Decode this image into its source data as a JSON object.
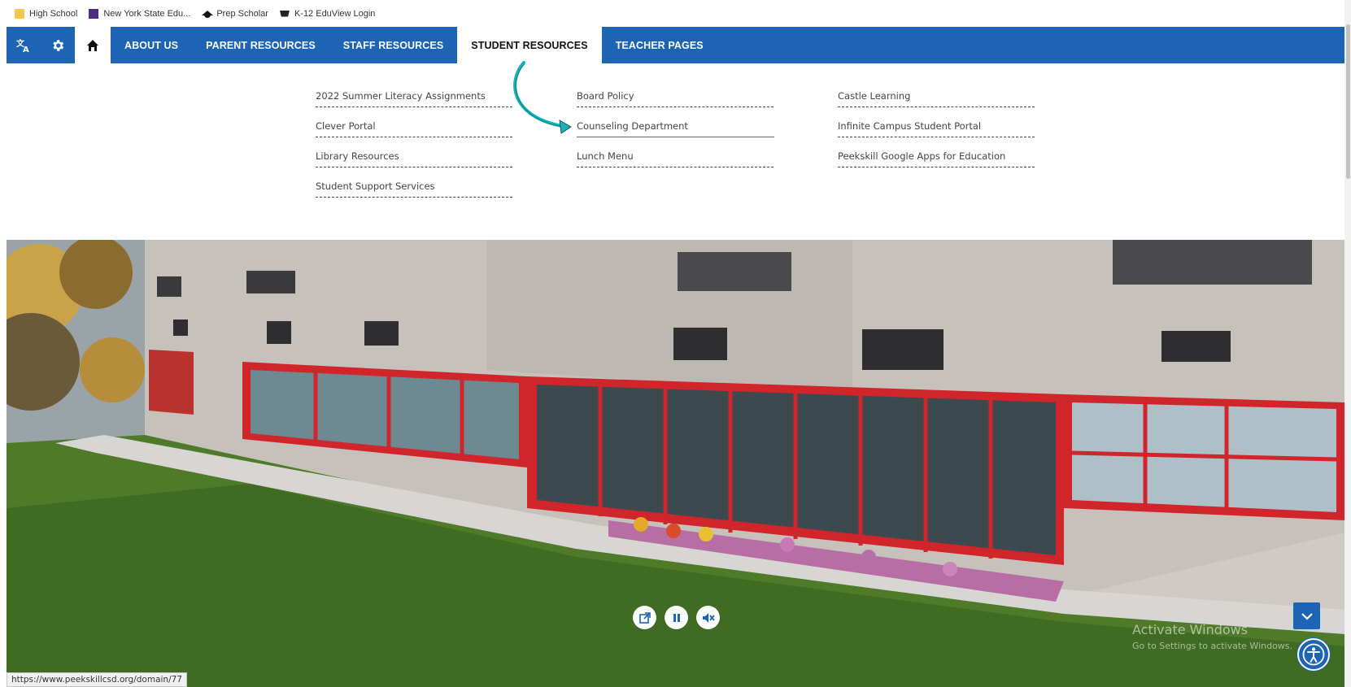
{
  "bookmarks": [
    {
      "label": "High School",
      "icon": "folder-icon"
    },
    {
      "label": "New York State Edu...",
      "icon": "nysed-logo-icon"
    },
    {
      "label": "Prep Scholar",
      "icon": "graduation-cap-icon"
    },
    {
      "label": "K-12 EduView Login",
      "icon": "k12-icon"
    }
  ],
  "nav": {
    "icons": [
      "translate-icon",
      "gear-icon",
      "home-icon"
    ],
    "items": [
      {
        "label": "ABOUT US"
      },
      {
        "label": "PARENT RESOURCES"
      },
      {
        "label": "STAFF RESOURCES"
      },
      {
        "label": "STUDENT RESOURCES",
        "active": true
      },
      {
        "label": "TEACHER PAGES"
      }
    ],
    "color": "#1e64b4"
  },
  "dropdown": {
    "col1": [
      "2022 Summer Literacy Assignments",
      "Clever Portal",
      "Library Resources",
      "Student Support Services"
    ],
    "col2": [
      "Board Policy",
      "Counseling Department",
      "Lunch Menu"
    ],
    "col3": [
      "Castle Learning",
      "Infinite Campus Student Portal",
      "Peekskill Google Apps for Education"
    ],
    "highlighted": "Counseling Department",
    "annotation_arrow_color": "#17b3b8"
  },
  "media": {
    "buttons": [
      "external-link-icon",
      "pause-icon",
      "mute-icon"
    ]
  },
  "watermark": {
    "title": "Activate Windows",
    "subtitle": "Go to Settings to activate Windows."
  },
  "status_url": "https://www.peekskillcsd.org/domain/77"
}
